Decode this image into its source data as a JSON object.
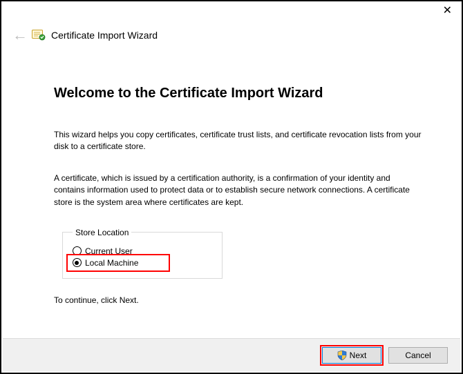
{
  "window": {
    "wizard_name": "Certificate Import Wizard"
  },
  "main": {
    "heading": "Welcome to the Certificate Import Wizard",
    "intro": "This wizard helps you copy certificates, certificate trust lists, and certificate revocation lists from your disk to a certificate store.",
    "description": "A certificate, which is issued by a certification authority, is a confirmation of your identity and contains information used to protect data or to establish secure network connections. A certificate store is the system area where certificates are kept.",
    "store_location_legend": "Store Location",
    "option_current_user": "Current User",
    "option_local_machine": "Local Machine",
    "selected_option": "local_machine",
    "continue_text": "To continue, click Next."
  },
  "footer": {
    "next_label": "Next",
    "cancel_label": "Cancel"
  }
}
